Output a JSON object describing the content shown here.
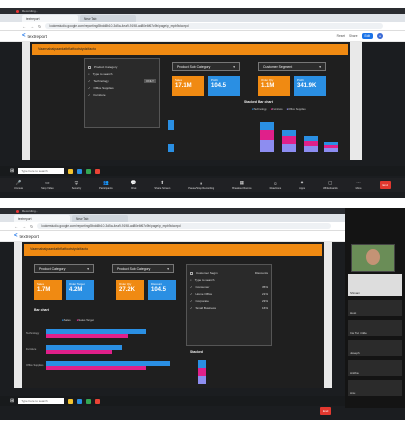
{
  "top": {
    "recorder_label": "Recording...",
    "tabs": [
      {
        "label": "textreport"
      },
      {
        "label": "New Tab"
      }
    ],
    "url": "lookerstudio.google.com/reporting/8bdd8b10-3d5a-4ea9-9198-ad80e6f67c9b/page/p_mpb9olwzpd",
    "app_name": "textreport",
    "app_actions": [
      "Reset",
      "Share",
      "Edit"
    ],
    "banner": "Vaarnabaipaardatbflatfootstydzifacto",
    "filters": [
      {
        "label": "Product Category",
        "open": true
      },
      {
        "label": "Product Sub Category"
      },
      {
        "label": "Customer Segment"
      }
    ],
    "dropdown_items": [
      "Type to search",
      "Technology",
      "Office Supplies",
      "Furniture"
    ],
    "dropdown_only": "ONLY",
    "cards": [
      {
        "label": "Sales",
        "value": "17.1M",
        "color": "orange"
      },
      {
        "label": "Profit",
        "value": "104.5",
        "color": "blue"
      },
      {
        "label": "Order Qty",
        "value": "1.1M",
        "color": "orange"
      },
      {
        "label": "Profit",
        "value": "341.9K",
        "color": "blue"
      }
    ],
    "chart_title": "Stacked Bar chart",
    "legend": [
      "Technology",
      "Furniture",
      "Office Supplies"
    ],
    "colors": {
      "technology": "#2a8fe3",
      "furniture": "#e0208a",
      "office": "#8d8df0",
      "orange": "#f08a12"
    },
    "taskbar_search": "Type here to search",
    "zoom_controls": [
      "Unmute",
      "Stop Video",
      "Security",
      "Participants",
      "Chat",
      "Share Screen",
      "Pause/Stop Recording",
      "Breakout Rooms",
      "Reactions",
      "Apps",
      "Whiteboards",
      "More"
    ],
    "end": "End"
  },
  "bottom": {
    "recorder_label": "Recording...",
    "tabs": [
      {
        "label": "textreport"
      },
      {
        "label": "New Tab"
      }
    ],
    "url": "lookerstudio.google.com/reporting/8bdd8b10-3d5a-4ea9-9198-ad80e6f67c9b/page/p_mpb9olwzpd",
    "app_name": "textreport",
    "banner": "Vaarnabaipaardatbflatfootstydzifacto",
    "filters": [
      {
        "label": "Product Category"
      },
      {
        "label": "Product Sub Category"
      },
      {
        "label": "Customer Segment",
        "open": true
      }
    ],
    "dropdown_items": [
      "Type to search",
      "Consumer",
      "Home Office",
      "Corporate",
      "Small Business"
    ],
    "dropdown_header": "Customer Segm",
    "dropdown_sub": "Discounts",
    "dropdown_values": [
      "35%",
      "21%",
      "23%",
      "16%"
    ],
    "cards": [
      {
        "label": "Sales",
        "value": "1.7M",
        "color": "orange"
      },
      {
        "label": "Order Target",
        "value": "4.2M",
        "color": "blue"
      },
      {
        "label": "Order Qty",
        "value": "27.2K",
        "color": "orange"
      },
      {
        "label": "Discount",
        "value": "104.5",
        "color": "blue"
      }
    ],
    "bar_title": "Bar chart",
    "bar_legend": [
      "Sales",
      "Sales Target"
    ],
    "bar_categories": [
      "Technology",
      "Furniture",
      "Office Supplies"
    ],
    "stacked_title": "Stacked",
    "taskbar_search": "Type here to search",
    "participants": [
      {
        "name": "Shivani"
      },
      {
        "name": "Host"
      },
      {
        "name": "Ins Tut i tilde"
      },
      {
        "name": "Joseph"
      },
      {
        "name": "Anitha"
      },
      {
        "name": "Anu"
      }
    ],
    "end": "End"
  }
}
